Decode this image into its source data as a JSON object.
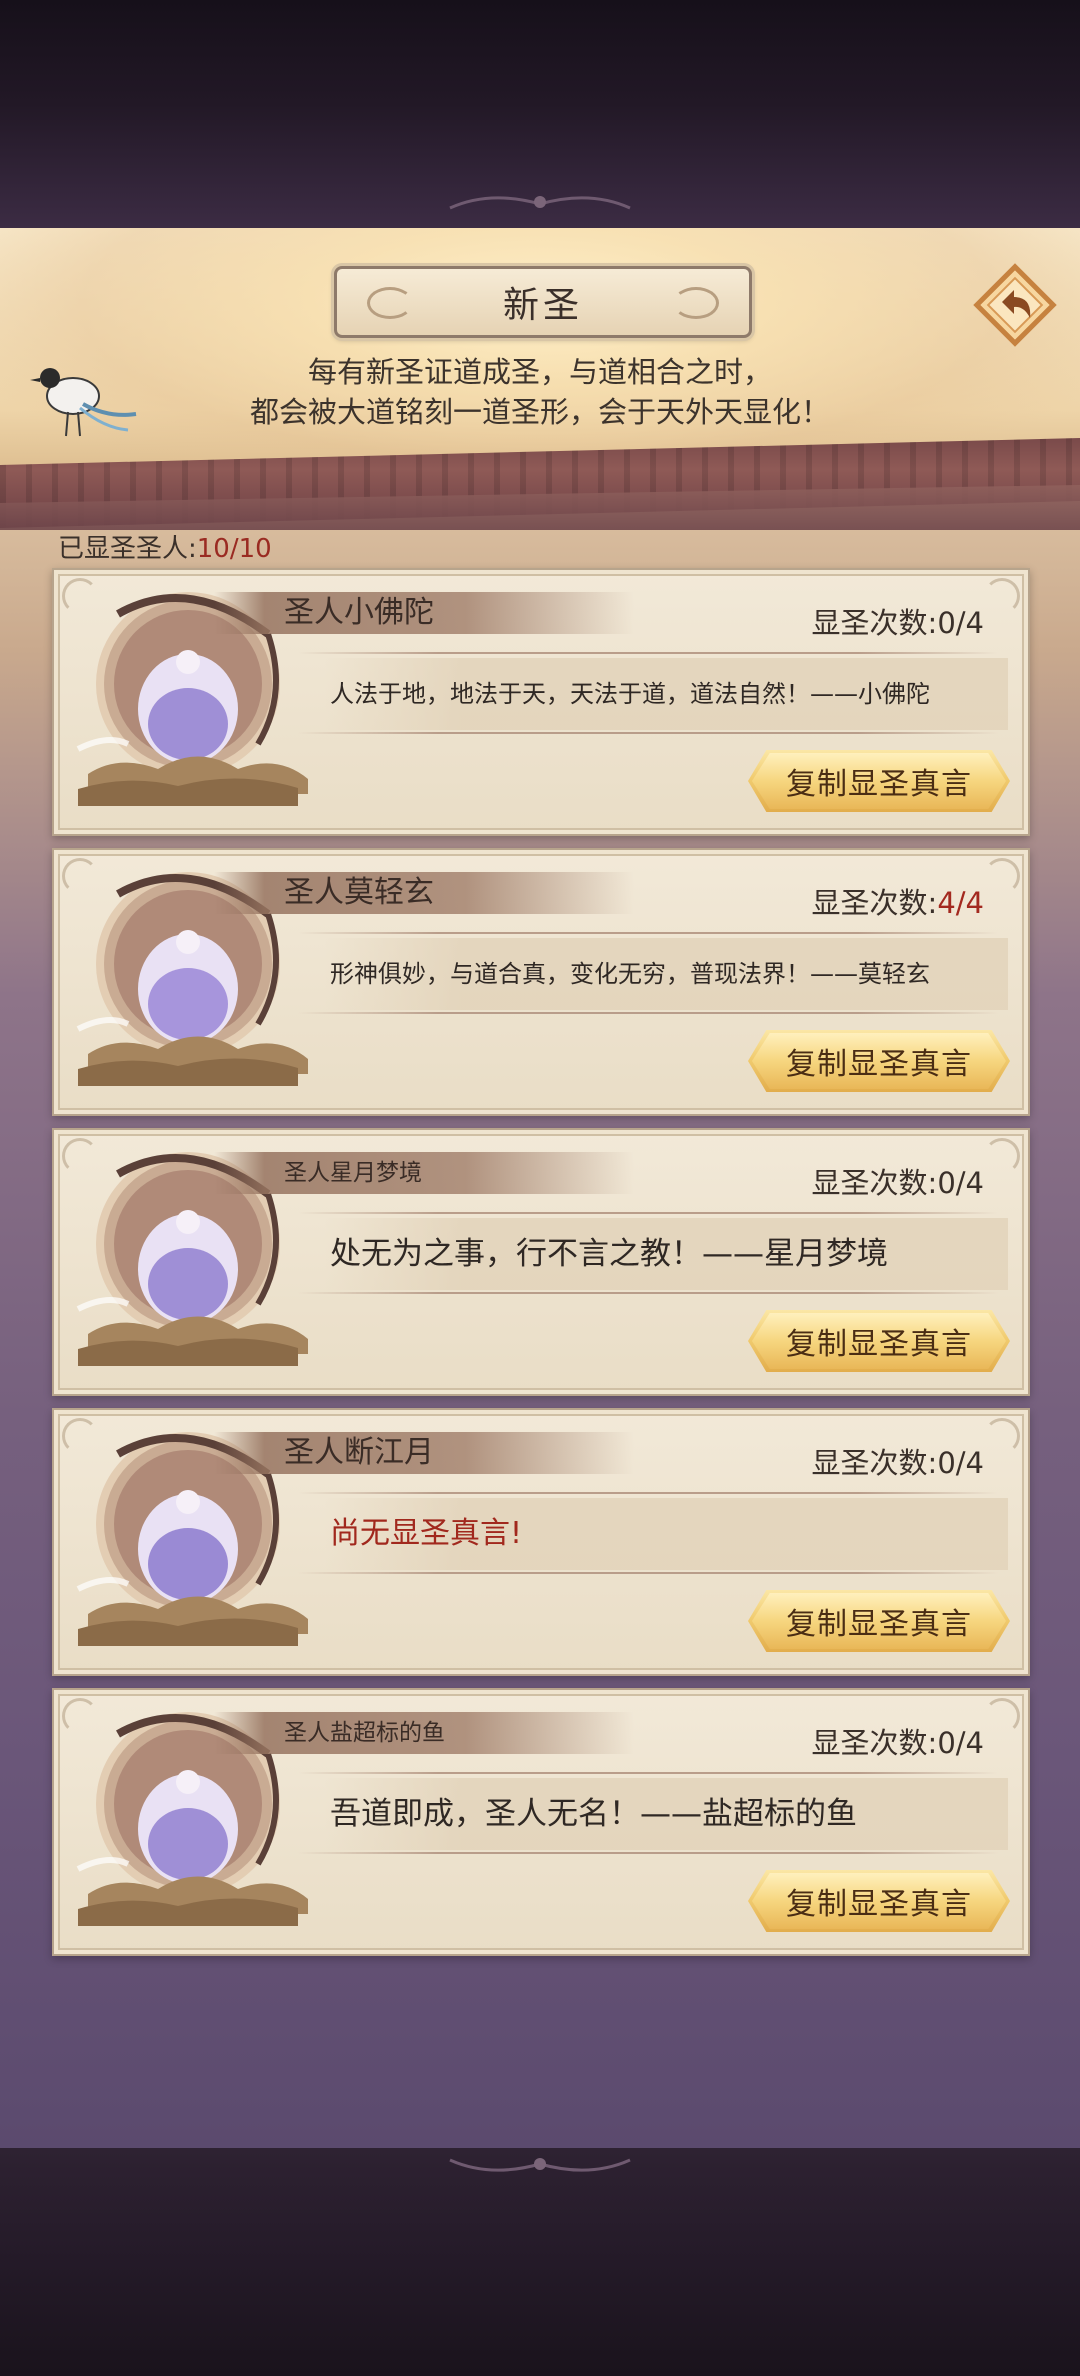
{
  "header": {
    "title": "新圣",
    "subtitle_line1": "每有新圣证道成圣，与道相合之时，",
    "subtitle_line2": "都会被大道铭刻一道圣形，会于天外天显化！",
    "back_icon": "back-arrow-icon"
  },
  "summary": {
    "label": "已显圣圣人:",
    "value": "10/10"
  },
  "cards": [
    {
      "name": "圣人小佛陀",
      "count_label": "显圣次数:",
      "count_value": "0/4",
      "quote": "人法于地，地法于天，天法于道，道法自然！——小佛陀",
      "button": "复制显圣真言"
    },
    {
      "name": "圣人莫轻玄",
      "count_label": "显圣次数:",
      "count_value": "4/4",
      "quote": "形神俱妙，与道合真，变化无穷，普现法界！——莫轻玄",
      "button": "复制显圣真言"
    },
    {
      "name": "圣人星月梦境",
      "count_label": "显圣次数:",
      "count_value": "0/4",
      "quote": "处无为之事，行不言之教！——星月梦境",
      "button": "复制显圣真言"
    },
    {
      "name": "圣人断江月",
      "count_label": "显圣次数:",
      "count_value": "0/4",
      "quote": "尚无显圣真言!",
      "button": "复制显圣真言"
    },
    {
      "name": "圣人盐超标的鱼",
      "count_label": "显圣次数:",
      "count_value": "0/4",
      "quote": "吾道即成，圣人无名！——盐超标的鱼",
      "button": "复制显圣真言"
    }
  ],
  "colors": {
    "accent_red": "#a3291f",
    "button_gold": "#f1cc70",
    "panel_paper": "#f2e9d8"
  }
}
